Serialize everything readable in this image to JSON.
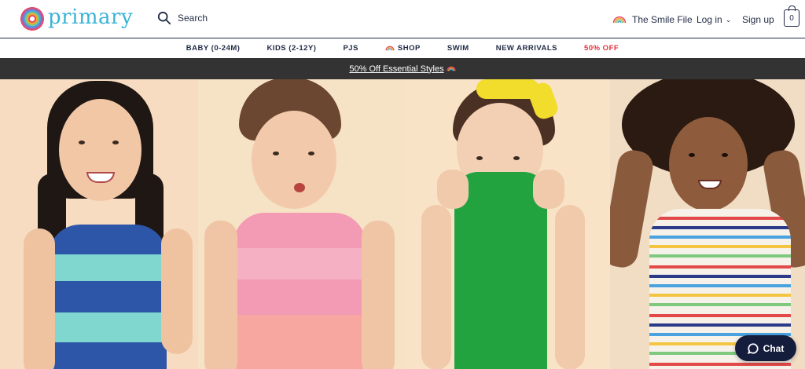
{
  "brand": {
    "name": "primary"
  },
  "search": {
    "label": "Search"
  },
  "account": {
    "smile_file": "The Smile File",
    "login": "Log in",
    "signup": "Sign up",
    "cart_count": "0"
  },
  "categories": [
    {
      "label": "BABY (0-24M)"
    },
    {
      "label": "KIDS (2-12Y)"
    },
    {
      "label": "PJS"
    },
    {
      "label": "SHOP"
    },
    {
      "label": "SWIM"
    },
    {
      "label": "NEW ARRIVALS"
    },
    {
      "label": "50% OFF"
    }
  ],
  "promo": {
    "text": "50% Off Essential Styles"
  },
  "chat": {
    "label": "Chat"
  },
  "colors": {
    "navy": "#1f2a44",
    "brand_teal": "#3bb3d6",
    "sale_red": "#e0313b",
    "promo_bg": "#333334",
    "chat_bg": "#151d3d"
  },
  "icons": [
    "search-icon",
    "rainbow-icon",
    "chevron-down-icon",
    "bag-icon",
    "chat-bubble-icon"
  ]
}
